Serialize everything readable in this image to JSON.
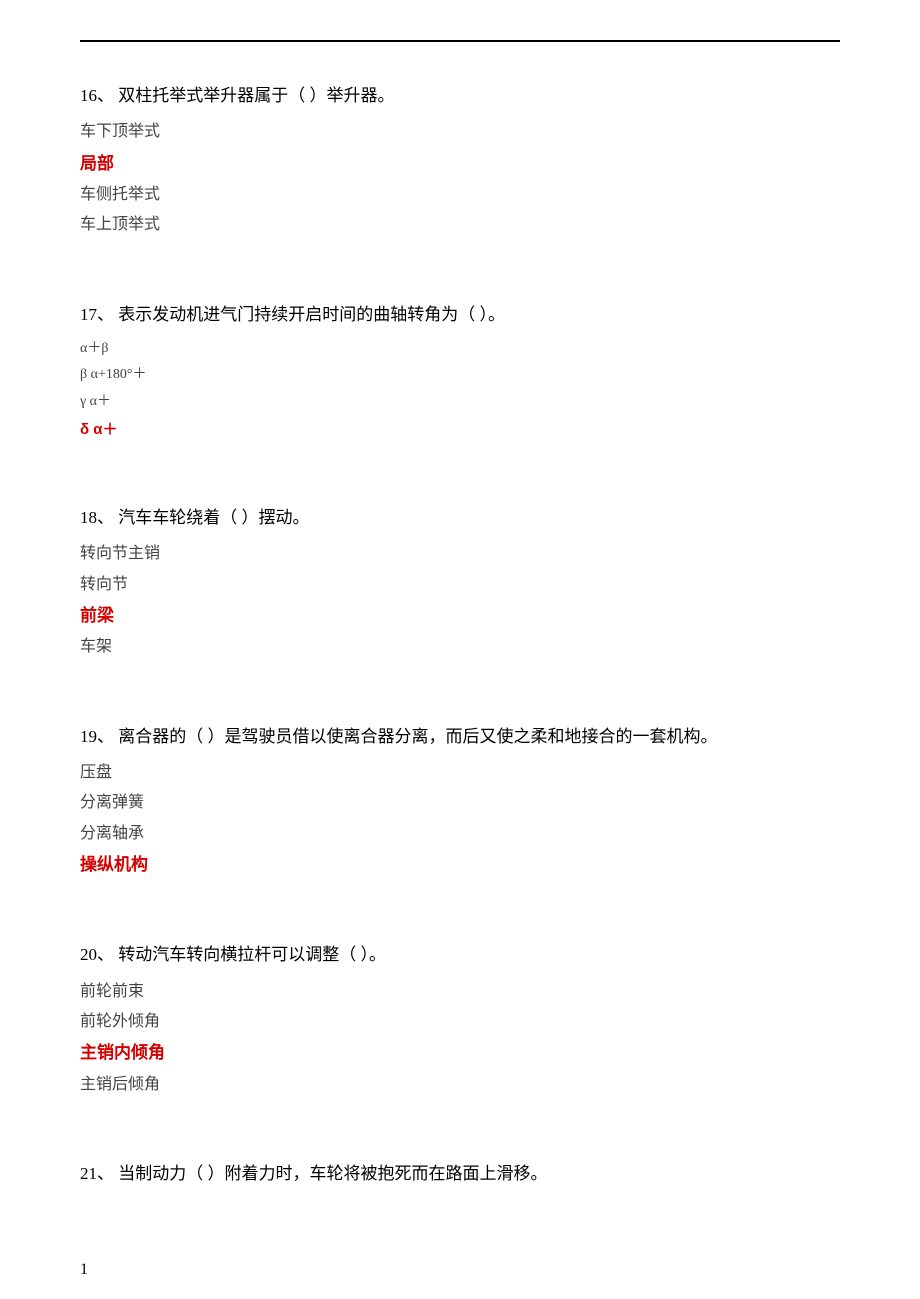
{
  "page_number": "1",
  "questions": [
    {
      "number": "16、",
      "stem": "双柱托举式举升器属于（ ）举升器。",
      "options": [
        "车下顶举式",
        "局部",
        "车侧托举式",
        "车上顶举式"
      ],
      "answer_index": 1,
      "small": false
    },
    {
      "number": "17、",
      "stem": "表示发动机进气门持续开启时间的曲轴转角为（ ）。",
      "options": [
        "α＋β",
        "β  α+180°＋",
        "γ  α＋",
        "δ  α＋"
      ],
      "answer_index": 3,
      "small": true
    },
    {
      "number": "18、",
      "stem": "汽车车轮绕着（ ）摆动。",
      "options": [
        "转向节主销",
        "转向节",
        "前梁",
        "车架"
      ],
      "answer_index": 2,
      "small": false
    },
    {
      "number": "19、",
      "stem": "离合器的（ ）是驾驶员借以使离合器分离，而后又使之柔和地接合的一套机构。",
      "options": [
        "压盘",
        "分离弹簧",
        "分离轴承",
        "操纵机构"
      ],
      "answer_index": 3,
      "small": false
    },
    {
      "number": "20、",
      "stem": "转动汽车转向横拉杆可以调整（ ）。",
      "options": [
        "前轮前束",
        "前轮外倾角",
        "主销内倾角",
        "主销后倾角"
      ],
      "answer_index": 2,
      "small": false
    },
    {
      "number": "21、",
      "stem": "当制动力（ ）附着力时，车轮将被抱死而在路面上滑移。",
      "options": [],
      "answer_index": -1,
      "small": false
    }
  ]
}
